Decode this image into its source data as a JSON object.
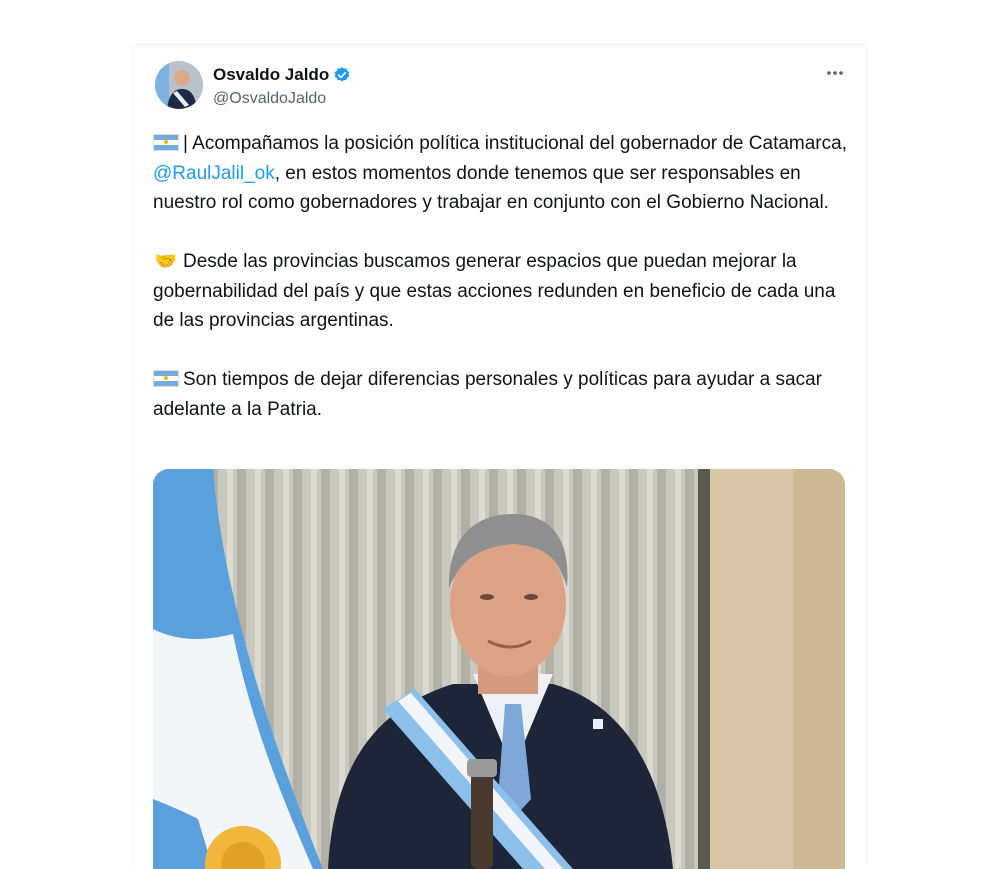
{
  "tweet": {
    "author_name": "Osvaldo Jaldo",
    "handle": "@OsvaldoJaldo",
    "paragraph1_prefix": "| Acompañamos la posición política institucional del gobernador de Catamarca, ",
    "mention": "@RaulJalil_ok",
    "paragraph1_suffix": ", en estos momentos donde tenemos que ser responsables en nuestro rol como gobernadores y trabajar en conjunto con el Gobierno Nacional.",
    "paragraph2": "Desde las provincias buscamos generar espacios que puedan mejorar la gobernabilidad del país y que estas acciones redunden en beneficio de cada una de las provincias argentinas.",
    "paragraph3": "Son tiempos de dejar diferencias personales y políticas para ayudar a sacar adelante a la Patria."
  },
  "icons": {
    "verified": "verified-badge-icon",
    "more": "more-options-icon",
    "flag": "argentina-flag-emoji",
    "handshake": "handshake-emoji"
  },
  "colors": {
    "text": "#0f1419",
    "secondary": "#536471",
    "link": "#1d9bf0",
    "flag_blue": "#75aadb"
  }
}
